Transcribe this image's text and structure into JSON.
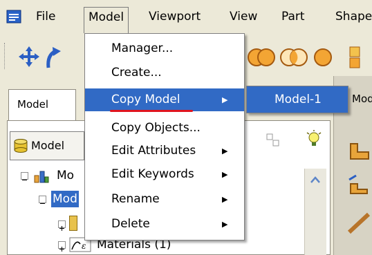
{
  "menubar": {
    "file": "File",
    "model": "Model",
    "viewport": "Viewport",
    "view": "View",
    "part": "Part",
    "shape": "Shape"
  },
  "left_panel": {
    "tab_label": "Model",
    "dropdown_label": "Model",
    "tree": {
      "root_label": "Mo",
      "model_label": "Mod",
      "materials_label": "Materials (1)"
    }
  },
  "right_panel": {
    "partial_label": "Mod"
  },
  "model_menu": {
    "items": [
      {
        "label": "Manager...",
        "has_submenu": false
      },
      {
        "label": "Create...",
        "has_submenu": false
      },
      {
        "label": "Copy Model",
        "has_submenu": true,
        "highlighted": true
      },
      {
        "label": "Copy Objects...",
        "has_submenu": false
      },
      {
        "label": "Edit Attributes",
        "has_submenu": true
      },
      {
        "label": "Edit Keywords",
        "has_submenu": true
      },
      {
        "label": "Rename",
        "has_submenu": true
      },
      {
        "label": "Delete",
        "has_submenu": true
      }
    ]
  },
  "copy_model_submenu": {
    "items": [
      {
        "label": "Model-1",
        "highlighted": true
      }
    ]
  },
  "colors": {
    "highlight": "#316ac5",
    "annotation_underline": "#e0141e",
    "window_bg": "#ece9d8"
  }
}
